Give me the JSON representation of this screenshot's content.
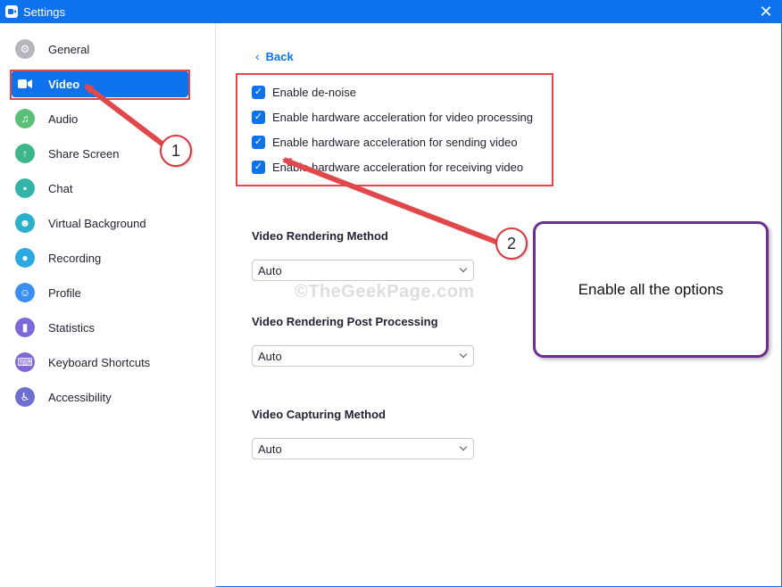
{
  "window": {
    "title": "Settings",
    "close_glyph": "✕"
  },
  "sidebar": {
    "items": [
      {
        "label": "General",
        "icon": "gear-icon",
        "color": "#b5b5bd",
        "glyph": "⚙"
      },
      {
        "label": "Video",
        "icon": "video-camera-icon",
        "color": "#0e72ed",
        "glyph": "■",
        "active": true
      },
      {
        "label": "Audio",
        "icon": "headphones-icon",
        "color": "#5bbf75",
        "glyph": "♫"
      },
      {
        "label": "Share Screen",
        "icon": "share-screen-icon",
        "color": "#3fb58a",
        "glyph": "↑"
      },
      {
        "label": "Chat",
        "icon": "chat-bubble-icon",
        "color": "#34b3a9",
        "glyph": "▪"
      },
      {
        "label": "Virtual Background",
        "icon": "person-background-icon",
        "color": "#2cb0c9",
        "glyph": "☻"
      },
      {
        "label": "Recording",
        "icon": "record-icon",
        "color": "#2ea8e0",
        "glyph": "●"
      },
      {
        "label": "Profile",
        "icon": "profile-icon",
        "color": "#3b8ff2",
        "glyph": "☺"
      },
      {
        "label": "Statistics",
        "icon": "statistics-icon",
        "color": "#7c68d8",
        "glyph": "▮"
      },
      {
        "label": "Keyboard Shortcuts",
        "icon": "keyboard-icon",
        "color": "#8168d6",
        "glyph": "⌨"
      },
      {
        "label": "Accessibility",
        "icon": "accessibility-icon",
        "color": "#6f6fcf",
        "glyph": "♿"
      }
    ]
  },
  "main": {
    "back_label": "Back",
    "back_glyph": "‹",
    "check_glyph": "✓",
    "options": [
      {
        "label": "Enable de-noise",
        "checked": true
      },
      {
        "label": "Enable hardware acceleration for video processing",
        "checked": true
      },
      {
        "label": "Enable hardware acceleration for sending video",
        "checked": true
      },
      {
        "label": "Enable hardware acceleration for receiving video",
        "checked": true
      }
    ],
    "rendering_method": {
      "title": "Video Rendering Method",
      "value": "Auto"
    },
    "post_processing": {
      "title": "Video Rendering Post Processing",
      "value": "Auto"
    },
    "capturing_method": {
      "title": "Video Capturing Method",
      "value": "Auto"
    }
  },
  "annotations": {
    "badge_1": "1",
    "badge_2": "2",
    "callout_text": "Enable all the options",
    "watermark": "©TheGeekPage.com",
    "arrow_color": "#e0484c",
    "callout_border_color": "#6b2f8f"
  },
  "theme": {
    "accent": "#0e72ed"
  }
}
